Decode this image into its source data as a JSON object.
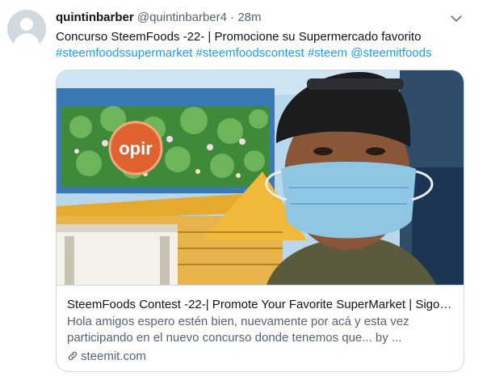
{
  "tweet": {
    "author_name": "quintinbarber",
    "author_handle": "@quintinbarber4",
    "separator": "·",
    "time": "28m",
    "text": "Concurso SteemFoods -22- | Promocione su Supermercado favorito",
    "hashtags": [
      "#steemfoodssupermarket",
      "#steemfoodscontest",
      "#steem",
      "@steemitfoods"
    ]
  },
  "card": {
    "title": "SteemFoods Contest -22-| Promote Your Favorite SuperMarket | Sigo l...",
    "description": "Hola amigos espero estén bien, nuevamente por acá y esta vez participando en el nuevo concurso donde tenemos que... by ...",
    "domain": "steemit.com",
    "sign_text": "opir"
  },
  "icons": {
    "caret": "chevron-down-icon",
    "link": "link-icon",
    "avatar": "default-avatar-icon"
  },
  "colors": {
    "link": "#1d9bf0",
    "secondary_text": "#536471",
    "border": "#cfd9de"
  }
}
